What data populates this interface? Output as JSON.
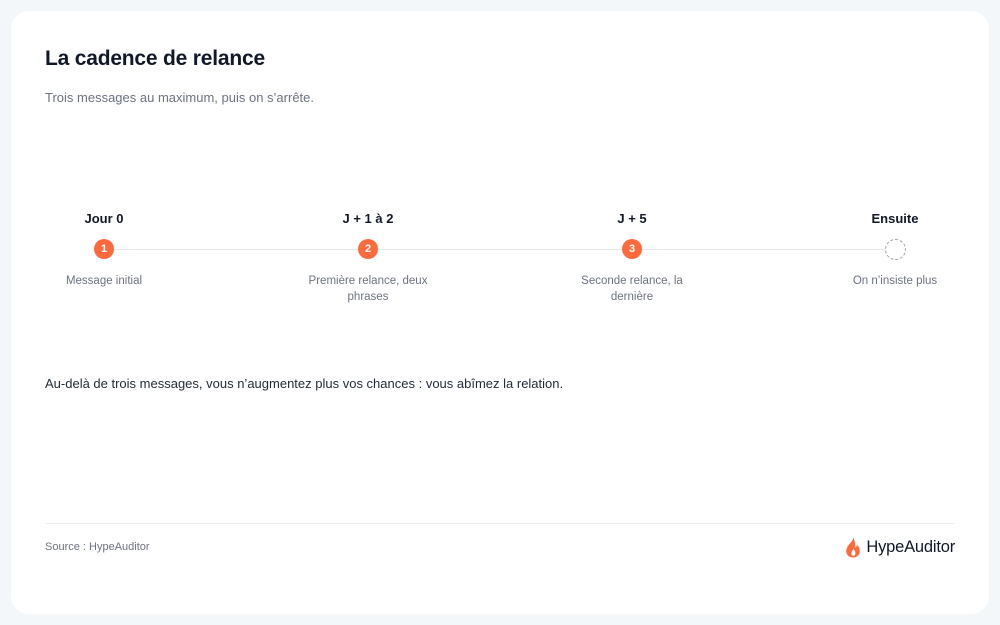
{
  "header": {
    "title": "La cadence de relance",
    "subtitle": "Trois messages au maximum, puis on s’arrête."
  },
  "timeline": {
    "steps": [
      {
        "label": "Jour 0",
        "marker": "1",
        "description": "Message initial",
        "state": "active"
      },
      {
        "label": "J + 1 à 2",
        "marker": "2",
        "description": "Première relance, deux phrases",
        "state": "active"
      },
      {
        "label": "J + 5",
        "marker": "3",
        "description": "Seconde relance, la dernière",
        "state": "active"
      },
      {
        "label": "Ensuite",
        "marker": "",
        "description": "On n’insiste plus",
        "state": "pending"
      }
    ],
    "accent_color": "#ff6a3d",
    "pending_color": "#9ca3af"
  },
  "note": "Au-delà de trois messages, vous n’augmentez plus vos chances : vous abîmez la relation.",
  "footer": {
    "source": "Source : HypeAuditor",
    "brand_name": "HypeAuditor",
    "brand_icon": "flame-icon"
  }
}
